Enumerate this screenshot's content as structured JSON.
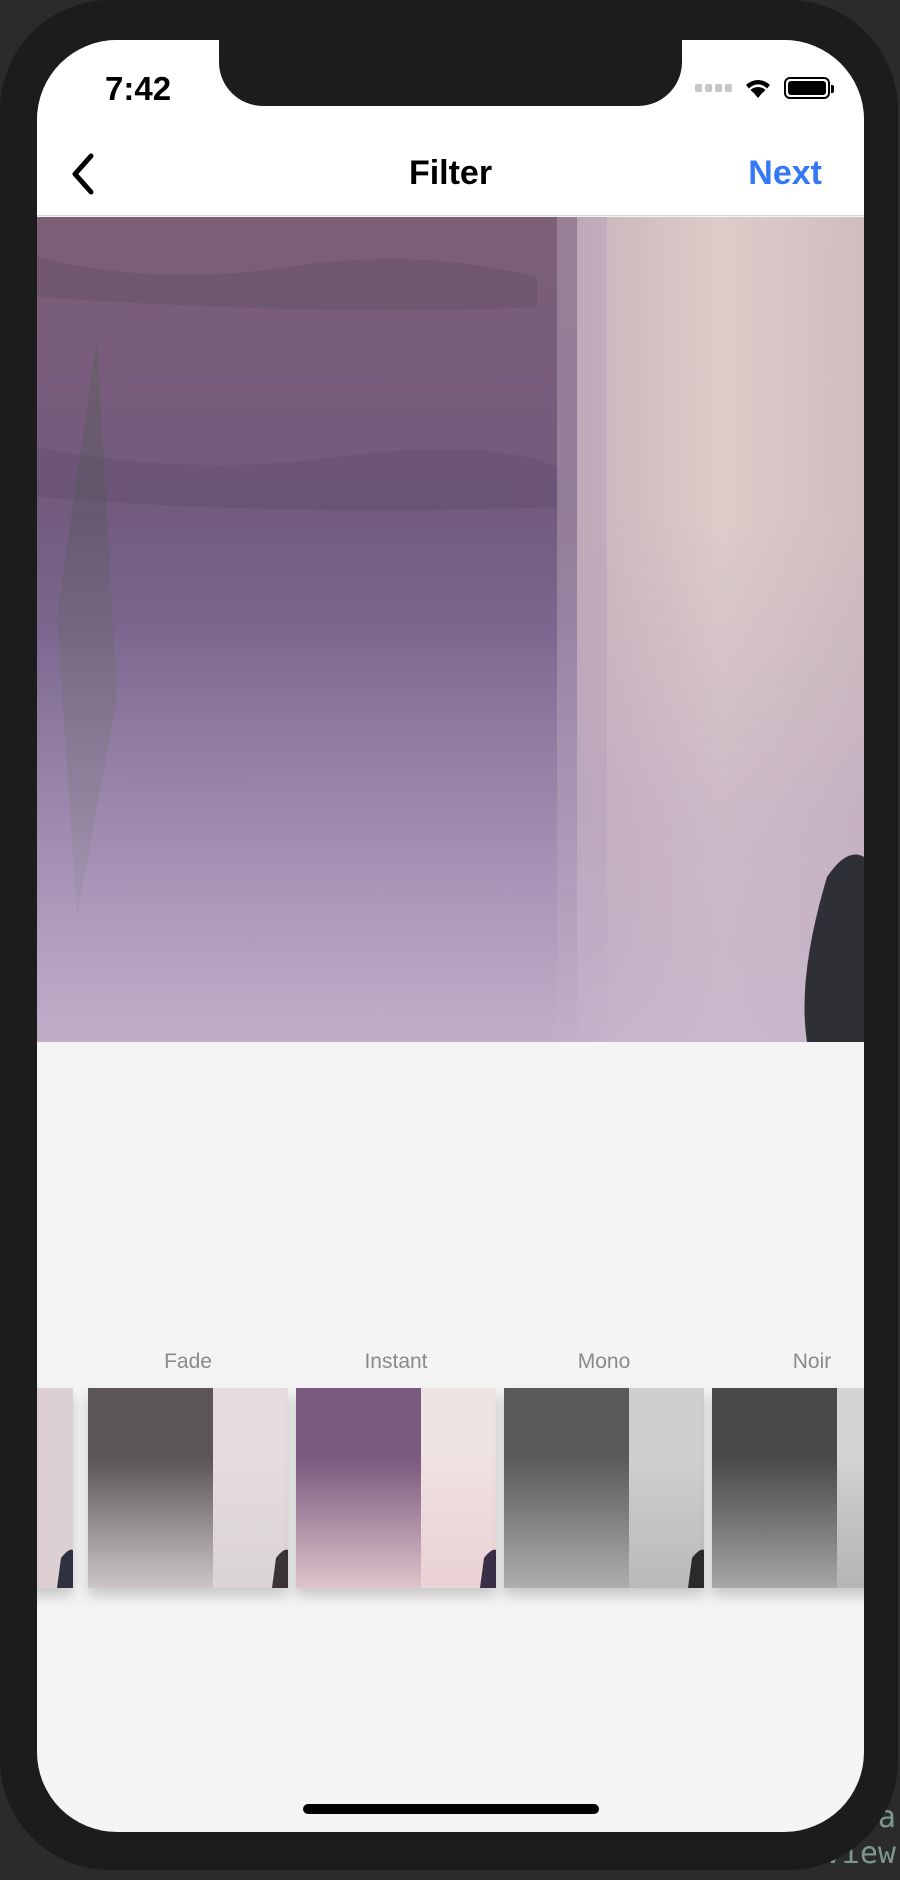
{
  "status_bar": {
    "time": "7:42"
  },
  "nav": {
    "title": "Filter",
    "next_label": "Next"
  },
  "filters": [
    {
      "label": "",
      "variant": "partial"
    },
    {
      "label": "Fade",
      "variant": "fade"
    },
    {
      "label": "Instant",
      "variant": "instant"
    },
    {
      "label": "Mono",
      "variant": "mono"
    },
    {
      "label": "Noir",
      "variant": "noir"
    }
  ],
  "background_code": [
    "Na",
    "View"
  ],
  "colors": {
    "accent": "#3478f6",
    "background": "#f4f4f4"
  }
}
